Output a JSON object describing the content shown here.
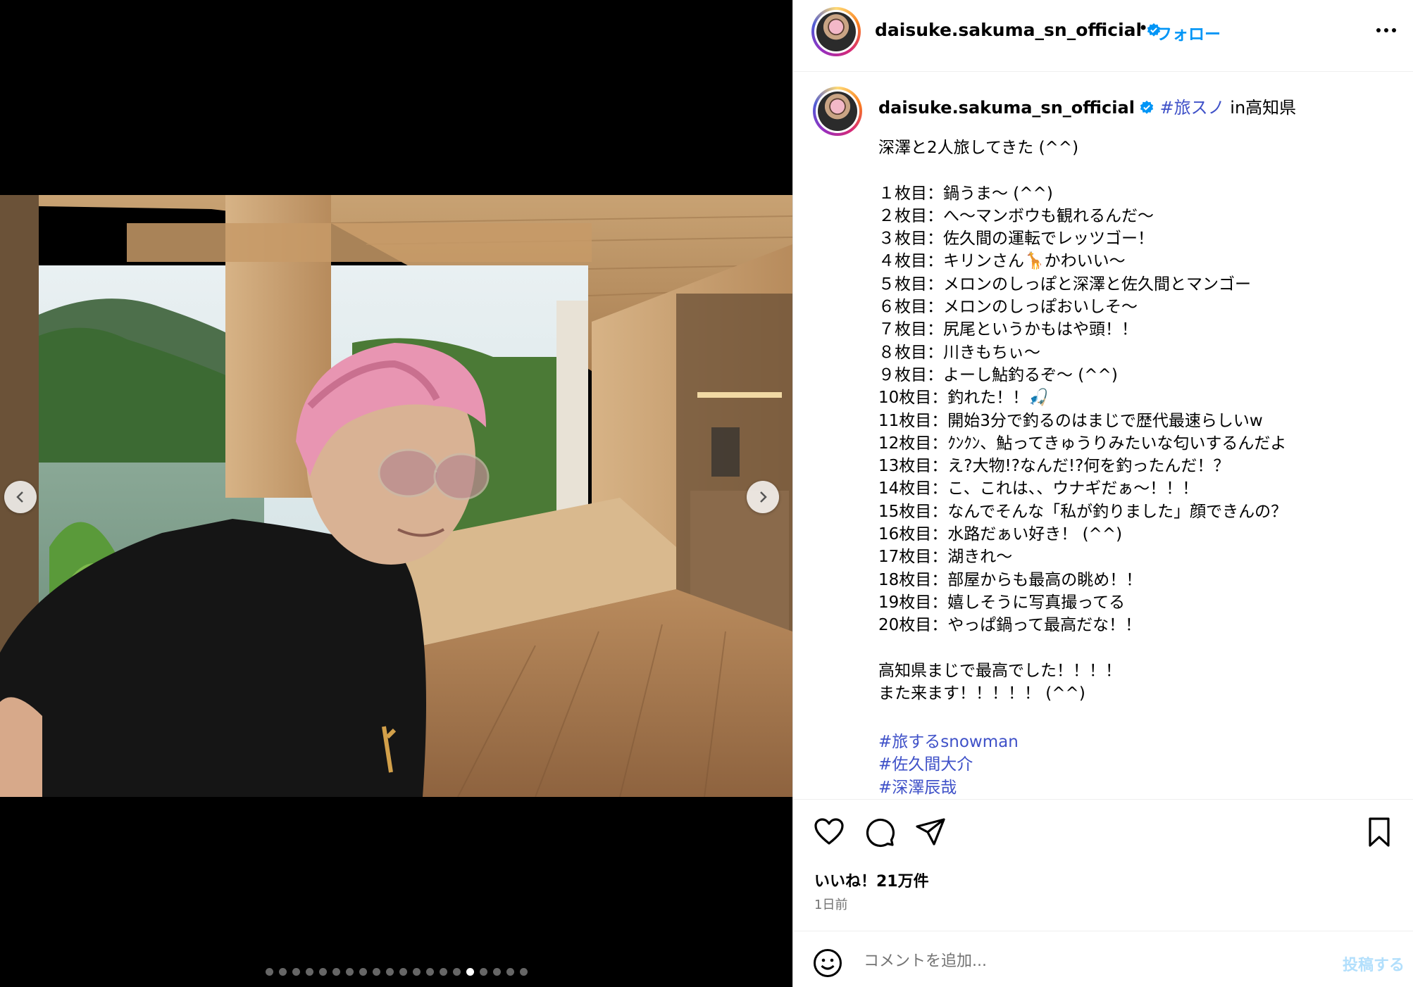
{
  "post": {
    "username": "daisuke.sakuma_sn_official",
    "separator": "•",
    "follow_label": "フォロー",
    "location_tag": "#旅スノ",
    "location_text": " in高知県"
  },
  "caption": {
    "lines": [
      "深澤と2人旅してきた (^^)",
      "",
      "１枚目：鍋うま〜 (^^)",
      "２枚目：へ〜マンボウも観れるんだ〜",
      "３枚目：佐久間の運転でレッツゴー！",
      "４枚目：キリンさん🦒かわいい〜",
      "５枚目：メロンのしっぽと深澤と佐久間とマンゴー",
      "６枚目：メロンのしっぽおいしそ〜",
      "７枚目：尻尾というかもはや頭！！",
      "８枚目：川きもちぃ〜",
      "９枚目：よーし鮎釣るぞ〜 (^^)",
      "10枚目：釣れた！！🎣",
      "11枚目：開始3分で釣るのはまじで歴代最速らしいw",
      "12枚目：ｸﾝｸﾝ、鮎ってきゅうりみたいな匂いするんだよ",
      "13枚目：え?大物!?なんだ!?何を釣ったんだ！？",
      "14枚目：こ、これは、、ウナギだぁ〜！！！",
      "15枚目：なんでそんな「私が釣りました」顔できんの？",
      "16枚目：水路だぁい好き！ (^^)",
      "17枚目：湖きれ〜",
      "18枚目：部屋からも最高の眺め！！",
      "19枚目：嬉しそうに写真撮ってる",
      "20枚目：やっぱ鍋って最高だな！！",
      "",
      "高知県まじで最高でした！！！！",
      "また来ます！！！！！ (^^)"
    ],
    "hashtags": [
      "#旅するsnowman",
      "#佐久間大介",
      "#深澤辰哉"
    ]
  },
  "engagement": {
    "likes": "いいね！21万件",
    "time": "1日前"
  },
  "comment": {
    "placeholder": "コメントを追加...",
    "post_label": "投稿する"
  },
  "carousel": {
    "total": 20,
    "active_index": 15
  },
  "icons": {
    "prev": "chevron-left-icon",
    "next": "chevron-right-icon",
    "like": "heart-icon",
    "comment": "comment-icon",
    "share": "paper-plane-icon",
    "save": "bookmark-icon",
    "emoji": "smiley-icon",
    "more": "more-options-icon",
    "verified": "verified-badge-icon"
  },
  "colors": {
    "link_blue": "#0095f6",
    "hashtag": "#3f51c8",
    "post_disabled": "#b2dffc"
  }
}
